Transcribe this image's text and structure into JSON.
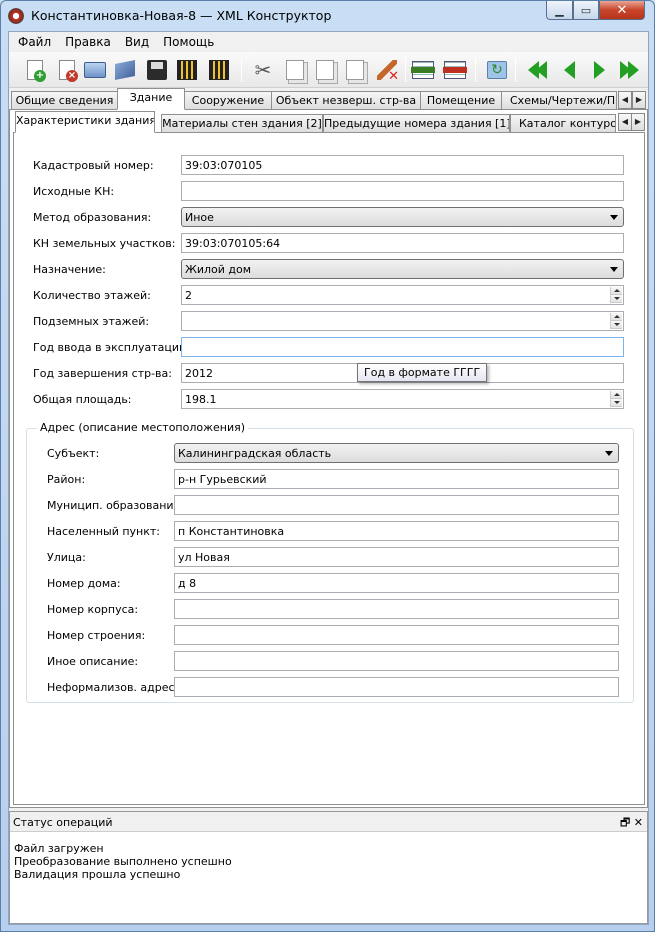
{
  "window": {
    "title": "Константиновка-Новая-8 — XML Конструктор"
  },
  "menu": [
    "Файл",
    "Правка",
    "Вид",
    "Помощь"
  ],
  "toolbar_icons": [
    "new-doc-icon",
    "close-doc-icon",
    "print-icon",
    "flash-icon",
    "save-icon",
    "film-icon",
    "film2-icon",
    "cut-icon",
    "copy-icon",
    "paste-icon",
    "paste-add-icon",
    "clear-icon",
    "insert-row-icon",
    "delete-row-icon",
    "refresh-icon",
    "first-icon",
    "prev-icon",
    "next-icon",
    "last-icon"
  ],
  "tabs_main": [
    "Общие сведения",
    "Здание",
    "Сооружение",
    "Объект незверш. стр-ва",
    "Помещение",
    "Схемы/Чертежи/Прил"
  ],
  "tabs_sub": [
    "Характеристики здания",
    "Материалы стен здания [2]",
    "Предыдущие номера здания [1]",
    "Каталог контуров"
  ],
  "form": {
    "cadastral_label": "Кадастровый номер:",
    "cadastral_value": "39:03:070105",
    "source_kn_label": "Исходные КН:",
    "source_kn_value": "",
    "method_label": "Метод образования:",
    "method_value": "Иное",
    "land_kn_label": "КН земельных участков:",
    "land_kn_value": "39:03:070105:64",
    "purpose_label": "Назначение:",
    "purpose_value": "Жилой дом",
    "floors_label": "Количество этажей:",
    "floors_value": "2",
    "underground_label": "Подземных этажей:",
    "underground_value": "",
    "year_commission_label": "Год ввода в эксплуатацию:",
    "year_commission_value": "",
    "year_built_label": "Год завершения стр-ва:",
    "year_built_value": "2012",
    "area_label": "Общая площадь:",
    "area_value": "198.1"
  },
  "tooltip": "Год в формате ГГГГ",
  "address": {
    "title": "Адрес (описание местоположения)",
    "subject_label": "Субъект:",
    "subject_value": "Калининградская область",
    "district_label": "Район:",
    "district_value": "р-н Гурьевский",
    "municipal_label": "Муницип. образование:",
    "municipal_value": "",
    "locality_label": "Населенный пункт:",
    "locality_value": "п Константиновка",
    "street_label": "Улица:",
    "street_value": "ул Новая",
    "house_label": "Номер дома:",
    "house_value": "д 8",
    "building_label": "Номер корпуса:",
    "building_value": "",
    "structure_label": "Номер строения:",
    "structure_value": "",
    "other_label": "Иное описание:",
    "other_value": "",
    "unformal_label": "Неформализов. адрес:",
    "unformal_value": ""
  },
  "status": {
    "title": "Статус операций",
    "log": [
      "Файл загружен",
      "Преобразование выполнено успешно",
      "Валидация прошла успешно"
    ]
  },
  "colors": {
    "accent_green": "#23a023",
    "close_red": "#c8452a"
  }
}
